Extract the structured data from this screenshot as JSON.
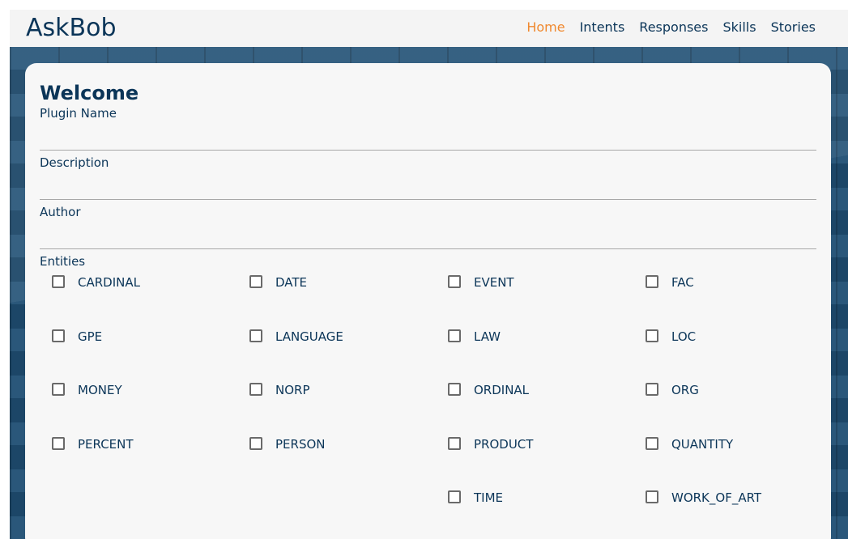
{
  "header": {
    "brand": "AskBob",
    "nav": [
      {
        "label": "Home",
        "active": true
      },
      {
        "label": "Intents",
        "active": false
      },
      {
        "label": "Responses",
        "active": false
      },
      {
        "label": "Skills",
        "active": false
      },
      {
        "label": "Stories",
        "active": false
      }
    ]
  },
  "colors": {
    "accent": "#f0892f",
    "text": "#0b3558",
    "background": "#1f4e73",
    "card": "#f7f7f7"
  },
  "card": {
    "title": "Welcome",
    "fields": {
      "plugin_name": {
        "label": "Plugin Name",
        "value": ""
      },
      "description": {
        "label": "Description",
        "value": ""
      },
      "author": {
        "label": "Author",
        "value": ""
      }
    },
    "entities_label": "Entities",
    "entities": [
      {
        "label": "CARDINAL",
        "checked": false
      },
      {
        "label": "DATE",
        "checked": false
      },
      {
        "label": "EVENT",
        "checked": false
      },
      {
        "label": "FAC",
        "checked": false
      },
      {
        "label": "GPE",
        "checked": false
      },
      {
        "label": "LANGUAGE",
        "checked": false
      },
      {
        "label": "LAW",
        "checked": false
      },
      {
        "label": "LOC",
        "checked": false
      },
      {
        "label": "MONEY",
        "checked": false
      },
      {
        "label": "NORP",
        "checked": false
      },
      {
        "label": "ORDINAL",
        "checked": false
      },
      {
        "label": "ORG",
        "checked": false
      },
      {
        "label": "PERCENT",
        "checked": false
      },
      {
        "label": "PERSON",
        "checked": false
      },
      {
        "label": "PRODUCT",
        "checked": false
      },
      {
        "label": "QUANTITY",
        "checked": false
      },
      {
        "label": "TIME",
        "checked": false
      },
      {
        "label": "WORK_OF_ART",
        "checked": false
      }
    ]
  }
}
